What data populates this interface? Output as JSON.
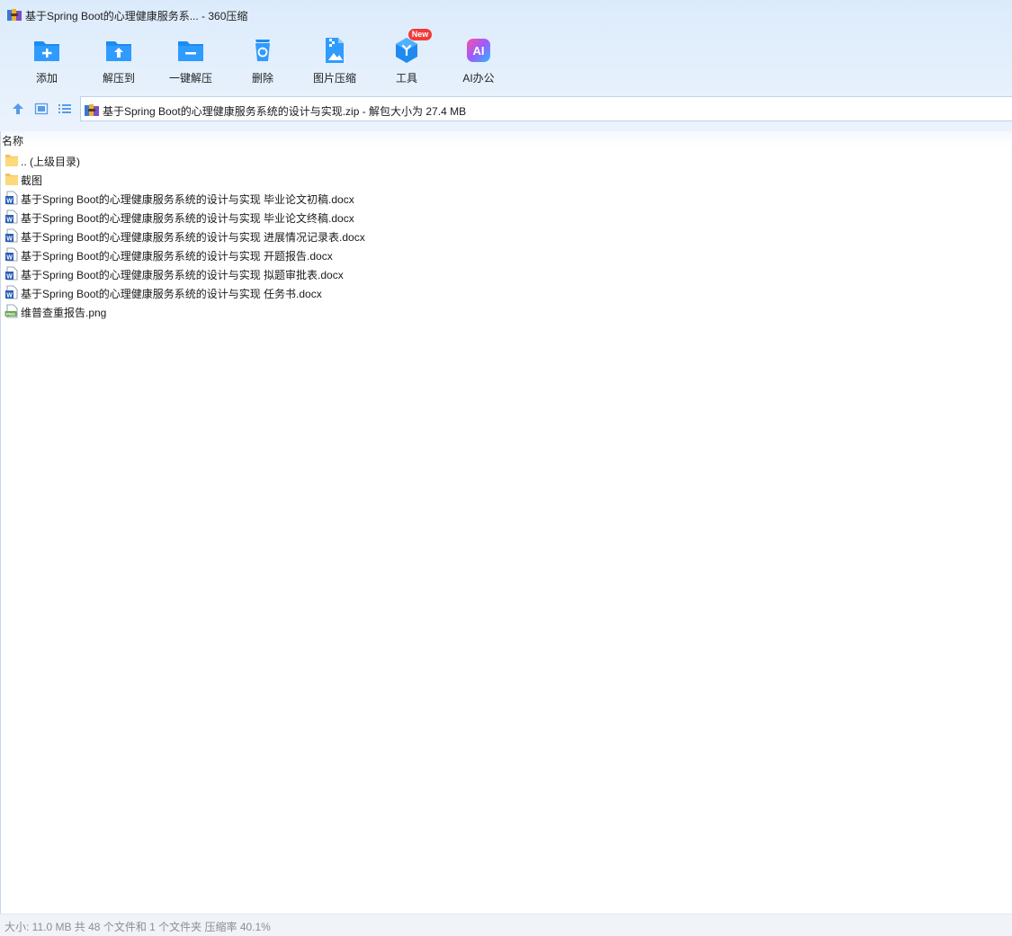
{
  "window": {
    "title": "基于Spring Boot的心理健康服务系... - 360压缩",
    "app_icon": "winrar-books-icon"
  },
  "toolbar": {
    "items": [
      {
        "label": "添加",
        "icon": "folder-add-icon"
      },
      {
        "label": "解压到",
        "icon": "folder-extract-icon"
      },
      {
        "label": "一键解压",
        "icon": "one-click-extract-icon"
      },
      {
        "label": "删除",
        "icon": "recycle-bin-icon"
      },
      {
        "label": "图片压缩",
        "icon": "image-compress-icon"
      },
      {
        "label": "工具",
        "icon": "tools-cube-icon",
        "badge": "New"
      },
      {
        "label": "AI办公",
        "icon": "ai-office-icon"
      }
    ]
  },
  "address": {
    "path": "基于Spring Boot的心理健康服务系统的设计与实现.zip - 解包大小为 27.4 MB"
  },
  "columns": {
    "name": "名称"
  },
  "files": [
    {
      "name": ".. (上级目录)",
      "type": "folder"
    },
    {
      "name": "截图",
      "type": "folder"
    },
    {
      "name": "基于Spring Boot的心理健康服务系统的设计与实现 毕业论文初稿.docx",
      "type": "docx"
    },
    {
      "name": "基于Spring Boot的心理健康服务系统的设计与实现 毕业论文终稿.docx",
      "type": "docx"
    },
    {
      "name": "基于Spring Boot的心理健康服务系统的设计与实现 进展情况记录表.docx",
      "type": "docx"
    },
    {
      "name": "基于Spring Boot的心理健康服务系统的设计与实现 开题报告.docx",
      "type": "docx"
    },
    {
      "name": "基于Spring Boot的心理健康服务系统的设计与实现 拟题审批表.docx",
      "type": "docx"
    },
    {
      "name": "基于Spring Boot的心理健康服务系统的设计与实现 任务书.docx",
      "type": "docx"
    },
    {
      "name": "维普查重报告.png",
      "type": "png"
    }
  ],
  "status": {
    "text": "大小: 11.0 MB 共 48 个文件和 1 个文件夹 压缩率 40.1%"
  },
  "colors": {
    "accent": "#1e8bf0",
    "badge": "#f03b3b",
    "header_bg": "#dcebfb"
  }
}
